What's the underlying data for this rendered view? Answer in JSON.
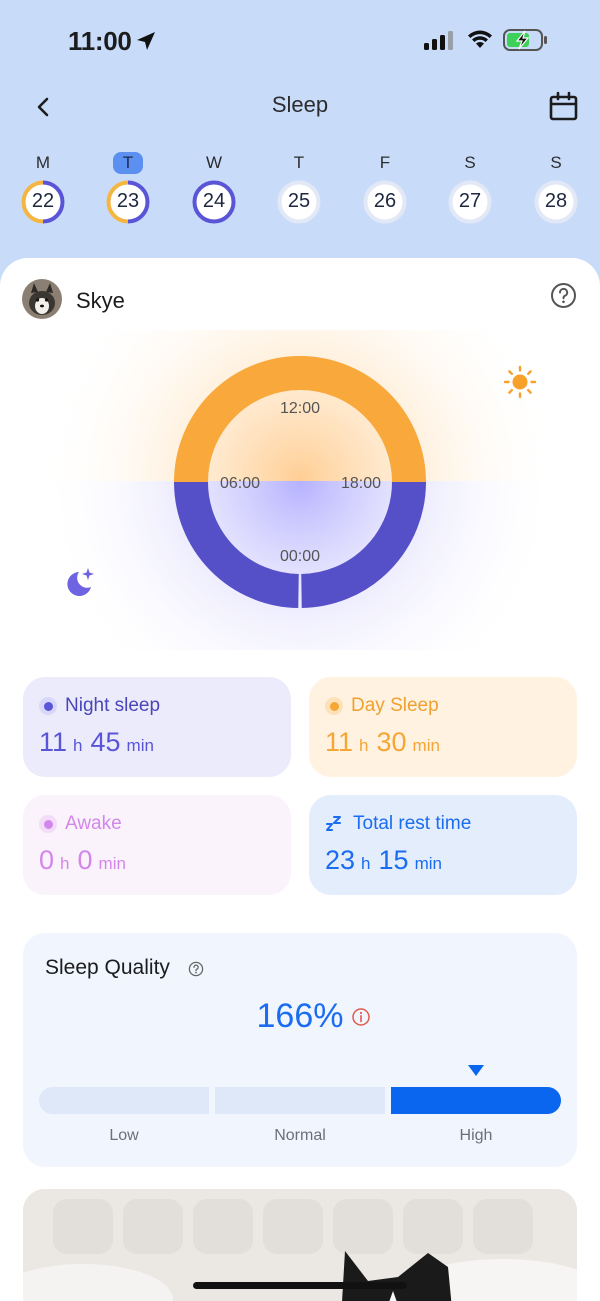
{
  "status_bar": {
    "time": "11:00"
  },
  "header": {
    "title": "Sleep"
  },
  "week": [
    {
      "letter": "M",
      "date": "22",
      "selected": false,
      "ring": "split"
    },
    {
      "letter": "T",
      "date": "23",
      "selected": true,
      "ring": "split"
    },
    {
      "letter": "W",
      "date": "24",
      "selected": false,
      "ring": "full"
    },
    {
      "letter": "T",
      "date": "25",
      "selected": false,
      "ring": "empty"
    },
    {
      "letter": "F",
      "date": "26",
      "selected": false,
      "ring": "empty"
    },
    {
      "letter": "S",
      "date": "27",
      "selected": false,
      "ring": "empty"
    },
    {
      "letter": "S",
      "date": "28",
      "selected": false,
      "ring": "empty"
    }
  ],
  "pet": {
    "name": "Skye"
  },
  "clock": {
    "labels": {
      "top": "12:00",
      "left": "06:00",
      "right": "18:00",
      "bottom": "00:00"
    },
    "day_color": "#f9a93b",
    "night_color": "#5550c8"
  },
  "stats": {
    "night": {
      "label": "Night sleep",
      "hours": "11",
      "h_unit": "h",
      "minutes": "45",
      "min_unit": "min",
      "color": "#5a55d6"
    },
    "day": {
      "label": "Day Sleep",
      "hours": "11",
      "h_unit": "h",
      "minutes": "30",
      "min_unit": "min",
      "color": "#f5a635"
    },
    "awake": {
      "label": "Awake",
      "hours": "0",
      "h_unit": "h",
      "minutes": "0",
      "min_unit": "min",
      "color": "#d386ec"
    },
    "total": {
      "label": "Total rest time",
      "hours": "23",
      "h_unit": "h",
      "minutes": "15",
      "min_unit": "min",
      "color": "#1a6cf0"
    }
  },
  "quality": {
    "title": "Sleep Quality",
    "value": "166%",
    "levels": [
      "Low",
      "Normal",
      "High"
    ],
    "active_level": "High"
  }
}
